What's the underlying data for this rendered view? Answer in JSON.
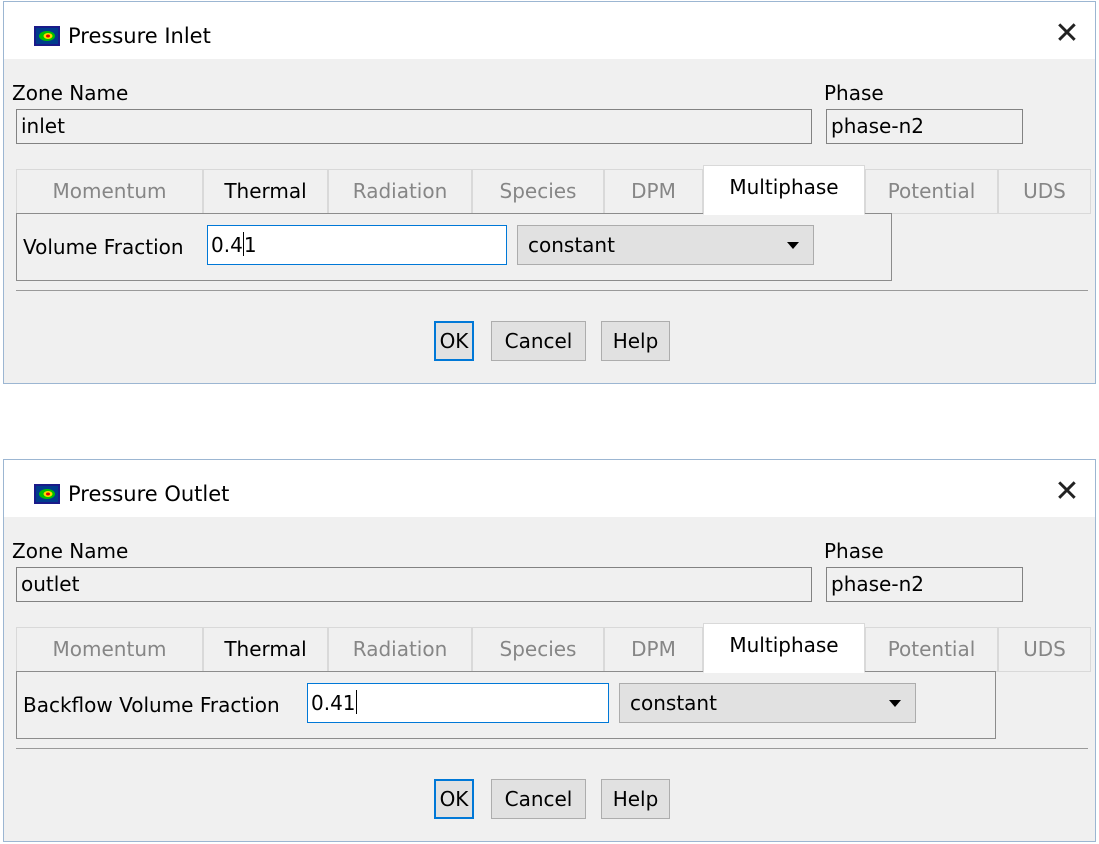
{
  "dialogs": [
    {
      "title": "Pressure Inlet",
      "zone_name_label": "Zone Name",
      "zone_name_value": "inlet",
      "phase_label": "Phase",
      "phase_value": "phase-n2",
      "tabs": [
        {
          "label": "Momentum",
          "state": "disabled"
        },
        {
          "label": "Thermal",
          "state": "enabled"
        },
        {
          "label": "Radiation",
          "state": "disabled"
        },
        {
          "label": "Species",
          "state": "disabled"
        },
        {
          "label": "DPM",
          "state": "disabled"
        },
        {
          "label": "Multiphase",
          "state": "selected"
        },
        {
          "label": "Potential",
          "state": "disabled"
        },
        {
          "label": "UDS",
          "state": "disabled"
        }
      ],
      "field_label": "Volume Fraction",
      "field_value_before_cursor": "0.4",
      "field_value_after_cursor": "1",
      "method_value": "constant",
      "ok_label": "OK",
      "cancel_label": "Cancel",
      "help_label": "Help"
    },
    {
      "title": "Pressure Outlet",
      "zone_name_label": "Zone Name",
      "zone_name_value": "outlet",
      "phase_label": "Phase",
      "phase_value": "phase-n2",
      "tabs": [
        {
          "label": "Momentum",
          "state": "disabled"
        },
        {
          "label": "Thermal",
          "state": "enabled"
        },
        {
          "label": "Radiation",
          "state": "disabled"
        },
        {
          "label": "Species",
          "state": "disabled"
        },
        {
          "label": "DPM",
          "state": "disabled"
        },
        {
          "label": "Multiphase",
          "state": "selected"
        },
        {
          "label": "Potential",
          "state": "disabled"
        },
        {
          "label": "UDS",
          "state": "disabled"
        }
      ],
      "field_label": "Backflow Volume Fraction",
      "field_value_before_cursor": "0.41",
      "field_value_after_cursor": "",
      "method_value": "constant",
      "ok_label": "OK",
      "cancel_label": "Cancel",
      "help_label": "Help"
    }
  ],
  "icons": {
    "app_icon": "fluent-app-icon",
    "close_icon": "close-icon",
    "dropdown_icon": "chevron-down-icon"
  },
  "colors": {
    "accent": "#0078d7",
    "dialog_bg": "#f0f0f0",
    "disabled_text": "#868686"
  }
}
